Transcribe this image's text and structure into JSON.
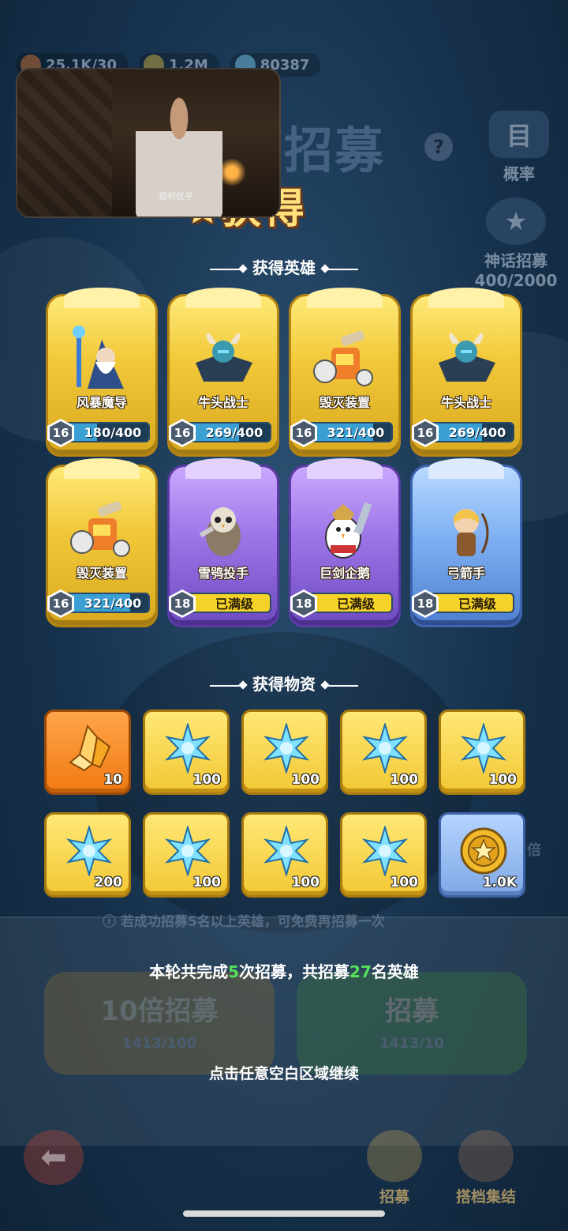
{
  "topbar": {
    "stamina": "25.1K/30",
    "gold": "1.2M",
    "gems": "80387"
  },
  "video": {
    "caption": "孤何忧乎"
  },
  "title": {
    "recruit": "招募",
    "gain": "获得"
  },
  "side": {
    "rate_label": "概率",
    "myth_label": "神话招募",
    "myth_progress": "400/2000"
  },
  "heroes_section": {
    "title": "获得英雄",
    "heroes": [
      {
        "name": "风暴魔导",
        "level": "16",
        "progress": "180/400",
        "rarity": "gold",
        "fill": 0.45
      },
      {
        "name": "牛头战士",
        "level": "16",
        "progress": "269/400",
        "rarity": "gold",
        "fill": 0.6725
      },
      {
        "name": "毁灭装置",
        "level": "16",
        "progress": "321/400",
        "rarity": "gold",
        "fill": 0.8025
      },
      {
        "name": "牛头战士",
        "level": "16",
        "progress": "269/400",
        "rarity": "gold",
        "fill": 0.6725
      },
      {
        "name": "毁灭装置",
        "level": "16",
        "progress": "321/400",
        "rarity": "gold",
        "fill": 0.8025
      },
      {
        "name": "雪鸮投手",
        "level": "18",
        "progress": "已满级",
        "rarity": "purple",
        "fill": 1
      },
      {
        "name": "巨剑企鹅",
        "level": "18",
        "progress": "已满级",
        "rarity": "purple",
        "fill": 1
      },
      {
        "name": "弓箭手",
        "level": "18",
        "progress": "已满级",
        "rarity": "blue",
        "fill": 1
      }
    ]
  },
  "items_section": {
    "title": "获得物资",
    "items": [
      {
        "type": "crystal",
        "count": "10",
        "rarity": "orange"
      },
      {
        "type": "snowflake",
        "count": "100",
        "rarity": "gold"
      },
      {
        "type": "snowflake",
        "count": "100",
        "rarity": "gold"
      },
      {
        "type": "snowflake",
        "count": "100",
        "rarity": "gold"
      },
      {
        "type": "snowflake",
        "count": "100",
        "rarity": "gold"
      },
      {
        "type": "snowflake",
        "count": "200",
        "rarity": "gold"
      },
      {
        "type": "snowflake",
        "count": "100",
        "rarity": "gold"
      },
      {
        "type": "snowflake",
        "count": "100",
        "rarity": "gold"
      },
      {
        "type": "snowflake",
        "count": "100",
        "rarity": "gold"
      },
      {
        "type": "coin",
        "count": "1.0K",
        "rarity": "blue"
      }
    ]
  },
  "background_hint": "若成功招募5名以上英雄，可免费再招募一次",
  "summary": {
    "part1": "本轮共完成",
    "recruit_times": "5",
    "part2": "次招募，共招募",
    "hero_count": "27",
    "part3": "名英雄"
  },
  "buttons": {
    "ten_label": "10倍招募",
    "ten_cost": "1413/100",
    "one_label": "招募",
    "one_cost": "1413/10",
    "side_mark": "倍"
  },
  "continue_text": "点击任意空白区域继续",
  "nav": {
    "recruit": "招募",
    "team": "搭档集结"
  },
  "colors": {
    "accent_green": "#56e05a",
    "gold_card": "#f2c93a",
    "purple_card": "#9b74e6",
    "blue_card": "#7db0f2"
  }
}
